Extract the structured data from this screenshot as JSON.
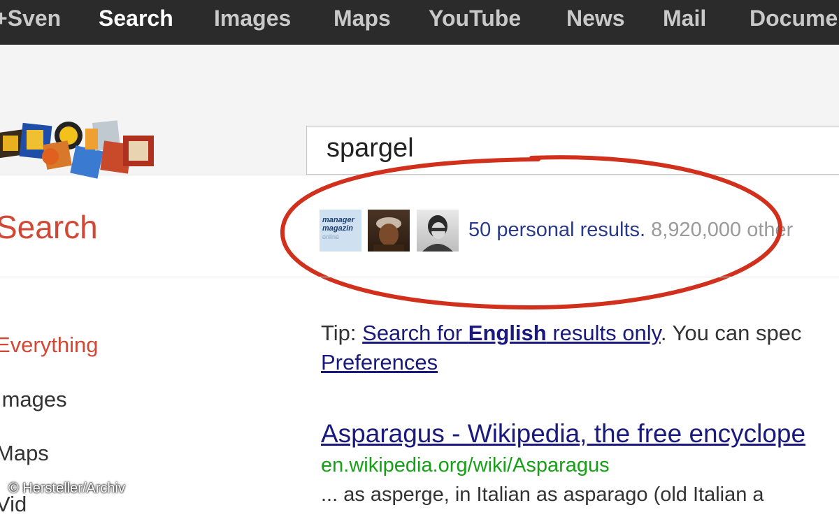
{
  "topbar": {
    "items": [
      {
        "label": "+Sven",
        "active": false
      },
      {
        "label": "Search",
        "active": true
      },
      {
        "label": "Images",
        "active": false
      },
      {
        "label": "Maps",
        "active": false
      },
      {
        "label": "YouTube",
        "active": false
      },
      {
        "label": "News",
        "active": false
      },
      {
        "label": "Mail",
        "active": false
      },
      {
        "label": "Docume",
        "active": false
      }
    ]
  },
  "search": {
    "value": "spargel"
  },
  "page_title": "Search",
  "personal_results": {
    "thumb_magazine": {
      "line1": "manager",
      "line2": "magazin",
      "line3": "online"
    },
    "count_text": "50 personal results.",
    "others_text": "8,920,000 other"
  },
  "sidenav": {
    "items": [
      {
        "label": "Everything",
        "active": true
      },
      {
        "label": "Images",
        "active": false
      },
      {
        "label": "Maps",
        "active": false
      },
      {
        "label": "Vid",
        "active": false
      }
    ]
  },
  "tip": {
    "prefix": "Tip: ",
    "link_pre": "Search for ",
    "link_bold": "English",
    "link_post": " results only",
    "suffix": ". You can spec",
    "preferences": "Preferences"
  },
  "result": {
    "title": "Asparagus - Wikipedia, the free encyclope",
    "url": "en.wikipedia.org/wiki/Asparagus",
    "snippet": "... as asperge, in Italian as asparago (old Italian a"
  },
  "credit": "© Hersteller/Archiv",
  "colors": {
    "accent": "#d14836",
    "link": "#1a1a7e",
    "url": "#16a016",
    "highlight": "#d0301c"
  }
}
